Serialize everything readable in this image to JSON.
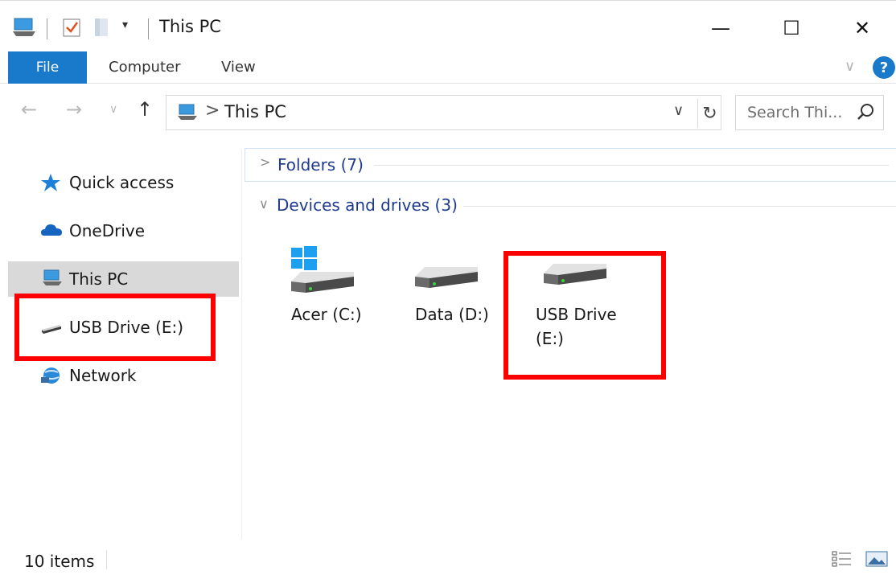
{
  "window": {
    "title": "This PC",
    "minimize": "—",
    "maximize": "☐",
    "close": "✕"
  },
  "qat": {
    "customize_glyph": "▾"
  },
  "ribbon": {
    "tabs": [
      {
        "label": "File",
        "active": true
      },
      {
        "label": "Computer"
      },
      {
        "label": "View"
      }
    ],
    "expand_glyph": "∨",
    "help_label": "?"
  },
  "nav": {
    "back_glyph": "←",
    "forward_glyph": "→",
    "recent_glyph": "∨",
    "up_glyph": "↑",
    "address_separator": ">",
    "address_text": "This PC",
    "address_dropdown_glyph": "∨",
    "refresh_glyph": "↻",
    "search_placeholder": "Search Thi..."
  },
  "sidebar": {
    "items": [
      {
        "label": "Quick access",
        "icon": "star-icon"
      },
      {
        "label": "OneDrive",
        "icon": "cloud-icon"
      },
      {
        "label": "This PC",
        "icon": "computer-icon",
        "selected": true
      },
      {
        "label": "USB Drive (E:)",
        "icon": "usb-drive-icon"
      },
      {
        "label": "Network",
        "icon": "network-icon"
      }
    ]
  },
  "content": {
    "groups": [
      {
        "label": "Folders (7)",
        "expanded": false,
        "chevron": ">"
      },
      {
        "label": "Devices and drives (3)",
        "expanded": true,
        "chevron": "∨"
      }
    ],
    "drives": [
      {
        "label": "Acer (C:)",
        "icon": "system-drive-icon"
      },
      {
        "label": "Data (D:)",
        "icon": "hard-drive-icon"
      },
      {
        "label": "USB Drive (E:)",
        "icon": "hard-drive-icon"
      }
    ]
  },
  "status": {
    "item_count": "10 items"
  },
  "colors": {
    "accent": "#1979ca",
    "highlight_box": "#ff0000",
    "group_header": "#1e3b8f",
    "selected_nav": "#d9d9d9"
  }
}
